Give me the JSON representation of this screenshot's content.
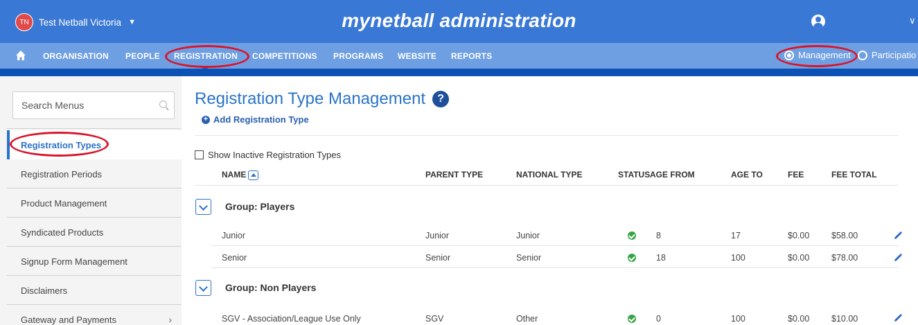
{
  "header": {
    "org_initials": "TN",
    "org_name": "Test Netball Victoria",
    "app_title": "mynetball administration",
    "icons": {
      "org_caret": "chevron-down-icon",
      "user": "user-circle-icon",
      "user_caret": "chevron-down-icon"
    }
  },
  "nav": {
    "home_icon": "home-icon",
    "items": [
      {
        "label": "ORGANISATION"
      },
      {
        "label": "PEOPLE"
      },
      {
        "label": "REGISTRATION",
        "active": true
      },
      {
        "label": "COMPETITIONS"
      },
      {
        "label": "PROGRAMS"
      },
      {
        "label": "WEBSITE"
      },
      {
        "label": "REPORTS"
      }
    ],
    "mode_options": [
      {
        "label": "Management",
        "selected": true
      },
      {
        "label": "Participatio",
        "selected": false
      }
    ]
  },
  "sidebar": {
    "search_placeholder": "Search Menus",
    "items": [
      {
        "label": "Registration Types",
        "active": true
      },
      {
        "label": "Registration Periods"
      },
      {
        "label": "Product Management"
      },
      {
        "label": "Syndicated Products"
      },
      {
        "label": "Signup Form Management"
      },
      {
        "label": "Disclaimers"
      },
      {
        "label": "Gateway and Payments",
        "has_submenu": true
      }
    ]
  },
  "main": {
    "title": "Registration Type Management",
    "help_icon": "help-icon",
    "add_label": "Add Registration Type",
    "show_inactive_label": "Show Inactive Registration Types",
    "show_inactive_checked": false,
    "columns": [
      "NAME",
      "PARENT TYPE",
      "NATIONAL TYPE",
      "STATUS",
      "AGE FROM",
      "AGE TO",
      "FEE",
      "FEE TOTAL"
    ],
    "groups": [
      {
        "label": "Group: Players",
        "rows": [
          {
            "name": "Junior",
            "parent": "Junior",
            "national": "Junior",
            "status": "active",
            "age_from": "8",
            "age_to": "17",
            "fee": "$0.00",
            "fee_total": "$58.00"
          },
          {
            "name": "Senior",
            "parent": "Senior",
            "national": "Senior",
            "status": "active",
            "age_from": "18",
            "age_to": "100",
            "fee": "$0.00",
            "fee_total": "$78.00"
          }
        ]
      },
      {
        "label": "Group: Non Players",
        "rows": [
          {
            "name": "SGV - Association/League Use Only",
            "parent": "SGV",
            "national": "Other",
            "status": "active",
            "age_from": "0",
            "age_to": "100",
            "fee": "$0.00",
            "fee_total": "$10.00"
          }
        ]
      }
    ]
  },
  "colors": {
    "topbar": "#3a78d6",
    "navbar": "#6f9fe3",
    "accent": "#2a72c9",
    "annotation": "#d9142b",
    "status_ok": "#36a446"
  }
}
